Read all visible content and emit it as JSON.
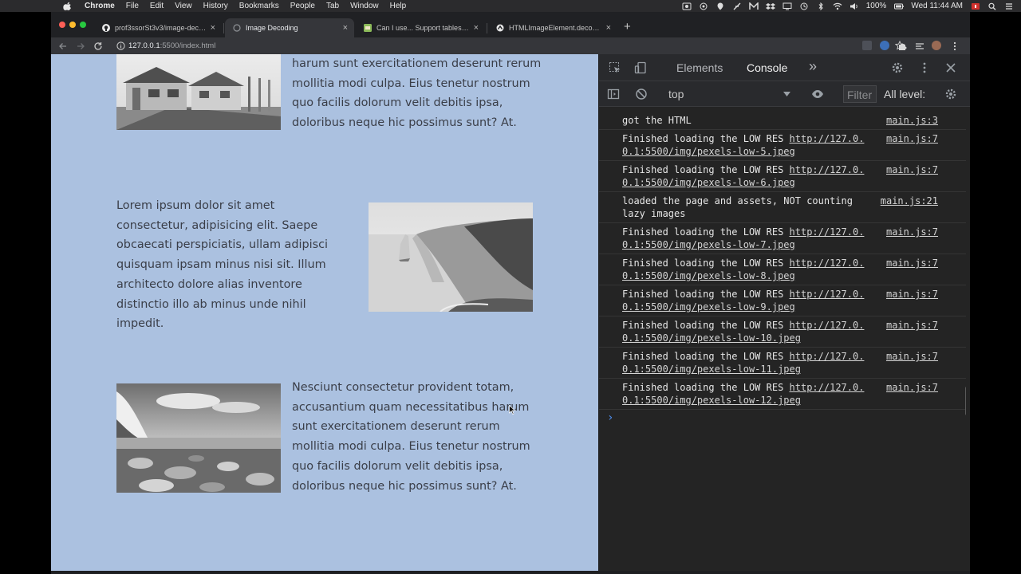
{
  "menubar": {
    "app": "Chrome",
    "items": [
      "File",
      "Edit",
      "View",
      "History",
      "Bookmarks",
      "People",
      "Tab",
      "Window",
      "Help"
    ],
    "battery": "100%",
    "clock": "Wed 11:44 AM"
  },
  "tabs": [
    {
      "title": "prof3ssorSt3v3/image-decode",
      "icon": "github-icon",
      "active": false
    },
    {
      "title": "Image Decoding",
      "icon": "globe-icon",
      "active": true
    },
    {
      "title": "Can I use... Support tables for",
      "icon": "caniuse-icon",
      "active": false
    },
    {
      "title": "HTMLImageElement.decode()",
      "icon": "mdn-icon",
      "active": false
    }
  ],
  "address_bar": {
    "host": "127.0.0.1",
    "path": ":5500/index.html"
  },
  "page": {
    "para_top": "harum sunt exercitationem deserunt rerum mollitia modi culpa. Eius tenetur nostrum quo facilis dolorum velit debitis ipsa, doloribus neque hic possimus sunt? At.",
    "para_mid": "Lorem ipsum dolor sit amet consectetur, adipisicing elit. Saepe obcaecati perspiciatis, ullam adipisci quisquam ipsam minus nisi sit. Illum architecto dolore alias inventore distinctio illo ab minus unde nihil impedit.",
    "para_bottom": "Nesciunt consectetur provident totam, accusantium quam necessitatibus harum sunt exercitationem deserunt rerum mollitia modi culpa. Eius tenetur nostrum quo facilis dolorum velit debitis ipsa, doloribus neque hic possimus sunt? At."
  },
  "devtools": {
    "tabs": [
      "Elements",
      "Console"
    ],
    "active_tab": "Console",
    "more_tabs": "»",
    "context": "top",
    "filter_placeholder": "Filter",
    "levels": "All level:",
    "logs": [
      {
        "text": "got the HTML",
        "link": "",
        "source": "main.js:3"
      },
      {
        "text": "Finished loading the LOW RES ",
        "link": "http://127.0.0.1:5500/img/pexels-low-5.jpeg",
        "source": "main.js:7"
      },
      {
        "text": "Finished loading the LOW RES ",
        "link": "http://127.0.0.1:5500/img/pexels-low-6.jpeg",
        "source": "main.js:7"
      },
      {
        "text": "loaded the page and assets, NOT counting lazy images",
        "link": "",
        "source": "main.js:21"
      },
      {
        "text": "Finished loading the LOW RES ",
        "link": "http://127.0.0.1:5500/img/pexels-low-7.jpeg",
        "source": "main.js:7"
      },
      {
        "text": "Finished loading the LOW RES ",
        "link": "http://127.0.0.1:5500/img/pexels-low-8.jpeg",
        "source": "main.js:7"
      },
      {
        "text": "Finished loading the LOW RES ",
        "link": "http://127.0.0.1:5500/img/pexels-low-9.jpeg",
        "source": "main.js:7"
      },
      {
        "text": "Finished loading the LOW RES ",
        "link": "http://127.0.0.1:5500/img/pexels-low-10.jpeg",
        "source": "main.js:7"
      },
      {
        "text": "Finished loading the LOW RES ",
        "link": "http://127.0.0.1:5500/img/pexels-low-11.jpeg",
        "source": "main.js:7"
      },
      {
        "text": "Finished loading the LOW RES ",
        "link": "http://127.0.0.1:5500/img/pexels-low-12.jpeg",
        "source": "main.js:7"
      }
    ],
    "prompt_symbol": "›"
  }
}
